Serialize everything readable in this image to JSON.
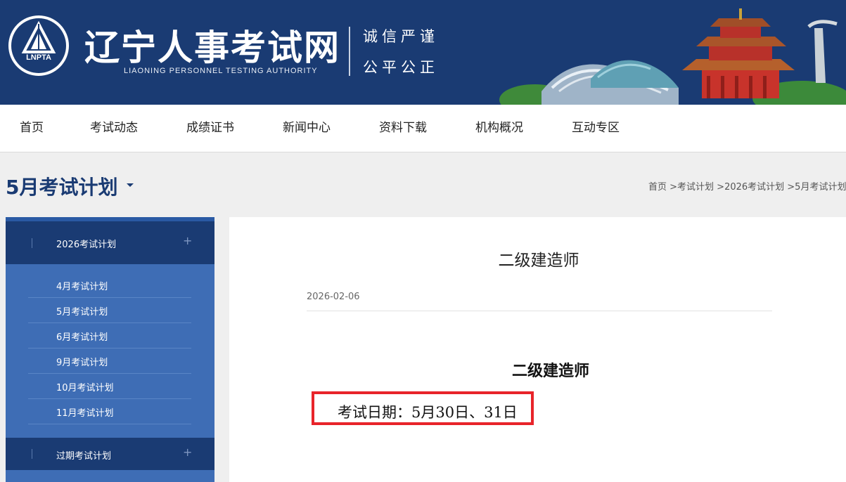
{
  "header": {
    "logo_text": "LNPTA",
    "title": "辽宁人事考试网",
    "subtitle": "LIAONING PERSONNEL TESTING AUTHORITY",
    "motto_line1": "诚信严谨",
    "motto_line2": "公平公正"
  },
  "nav": {
    "items": [
      "首页",
      "考试动态",
      "成绩证书",
      "新闻中心",
      "资料下载",
      "机构概况",
      "互动专区"
    ]
  },
  "page": {
    "title": "5月考试计划",
    "breadcrumb": [
      "首页",
      " >考试计划",
      " >2026考试计划",
      " >5月考试计划"
    ]
  },
  "sidebar": {
    "group1": "2026考试计划",
    "items": [
      "4月考试计划",
      "5月考试计划",
      "6月考试计划",
      "9月考试计划",
      "10月考试计划",
      "11月考试计划"
    ],
    "group2": "过期考试计划",
    "plus": "+"
  },
  "article": {
    "title": "二级建造师",
    "date": "2026-02-06",
    "heading": "二级建造师",
    "line": "考试日期：5月30日、31日"
  },
  "colors": {
    "brand": "#1a3b73",
    "sidebar": "#3e6db5",
    "highlight": "#e8242a"
  }
}
